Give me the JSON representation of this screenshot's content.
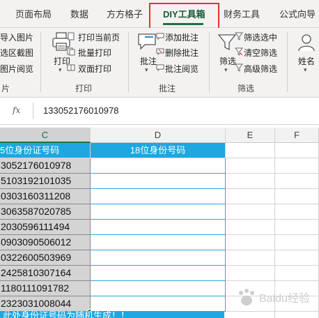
{
  "tabs": {
    "page_layout": "页面布局",
    "data": "数据",
    "fangfang": "方方格子",
    "diy": "DIY工具箱",
    "finance": "财务工具",
    "formula": "公式向导"
  },
  "ribbon": {
    "image_group": {
      "import_image": "导入图片",
      "region_capture": "选区截图",
      "image_browse": "图片阅览",
      "label": "片"
    },
    "print_group": {
      "print": "打印",
      "print_current_page": "打印当前页",
      "batch_print": "批量打印",
      "duplex_print": "双面打印",
      "label": "打印"
    },
    "comment_group": {
      "comment": "批注",
      "add_comment": "添加批注",
      "delete_comment": "删除批注",
      "comment_browse": "批注阅览",
      "label": "批注"
    },
    "filter_group": {
      "filter": "筛选",
      "filter_selected": "筛选选中",
      "clear_filter": "清空筛选",
      "advanced_filter": "高级筛选",
      "label": "筛选"
    },
    "name_group": {
      "name": "姓名"
    }
  },
  "formula_bar": {
    "fx": "fx",
    "value": "133052176010978"
  },
  "columns": [
    "C",
    "D",
    "E",
    "F"
  ],
  "header_row": {
    "c": "5位身份证号码",
    "d": "18位身份号码"
  },
  "rows": [
    "3052176010978",
    "5103192101035",
    "0303160311208",
    "3063587020785",
    "2030596111494",
    "0903090506012",
    "0322600503969",
    "2425810307164",
    "1180111091782",
    "2323031008044"
  ],
  "footer_note": "此处身份证号码为随机生成！！",
  "watermark": "Baidu经验"
}
